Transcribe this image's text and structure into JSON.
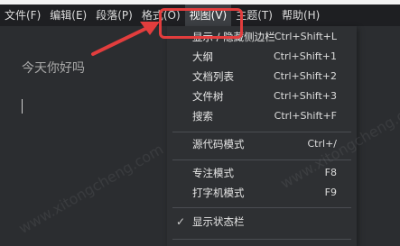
{
  "menubar": {
    "items": [
      {
        "label": "文件(F)"
      },
      {
        "label": "编辑(E)"
      },
      {
        "label": "段落(P)"
      },
      {
        "label": "格式(O)"
      },
      {
        "label": "视图(V)"
      },
      {
        "label": "主题(T)"
      },
      {
        "label": "帮助(H)"
      }
    ]
  },
  "editor": {
    "content": "今天你好吗"
  },
  "view_menu": {
    "items": [
      {
        "label": "显示 / 隐藏侧边栏",
        "shortcut": "Ctrl+Shift+L"
      },
      {
        "label": "大纲",
        "shortcut": "Ctrl+Shift+1"
      },
      {
        "label": "文档列表",
        "shortcut": "Ctrl+Shift+2"
      },
      {
        "label": "文件树",
        "shortcut": "Ctrl+Shift+3"
      },
      {
        "label": "搜索",
        "shortcut": "Ctrl+Shift+F"
      },
      {
        "label": "源代码模式",
        "shortcut": "Ctrl+/"
      },
      {
        "label": "专注模式",
        "shortcut": "F8"
      },
      {
        "label": "打字机模式",
        "shortcut": "F9"
      },
      {
        "label": "显示状态栏",
        "shortcut": "",
        "checked": true
      }
    ]
  },
  "annotation": {
    "color": "#e23d3d"
  }
}
